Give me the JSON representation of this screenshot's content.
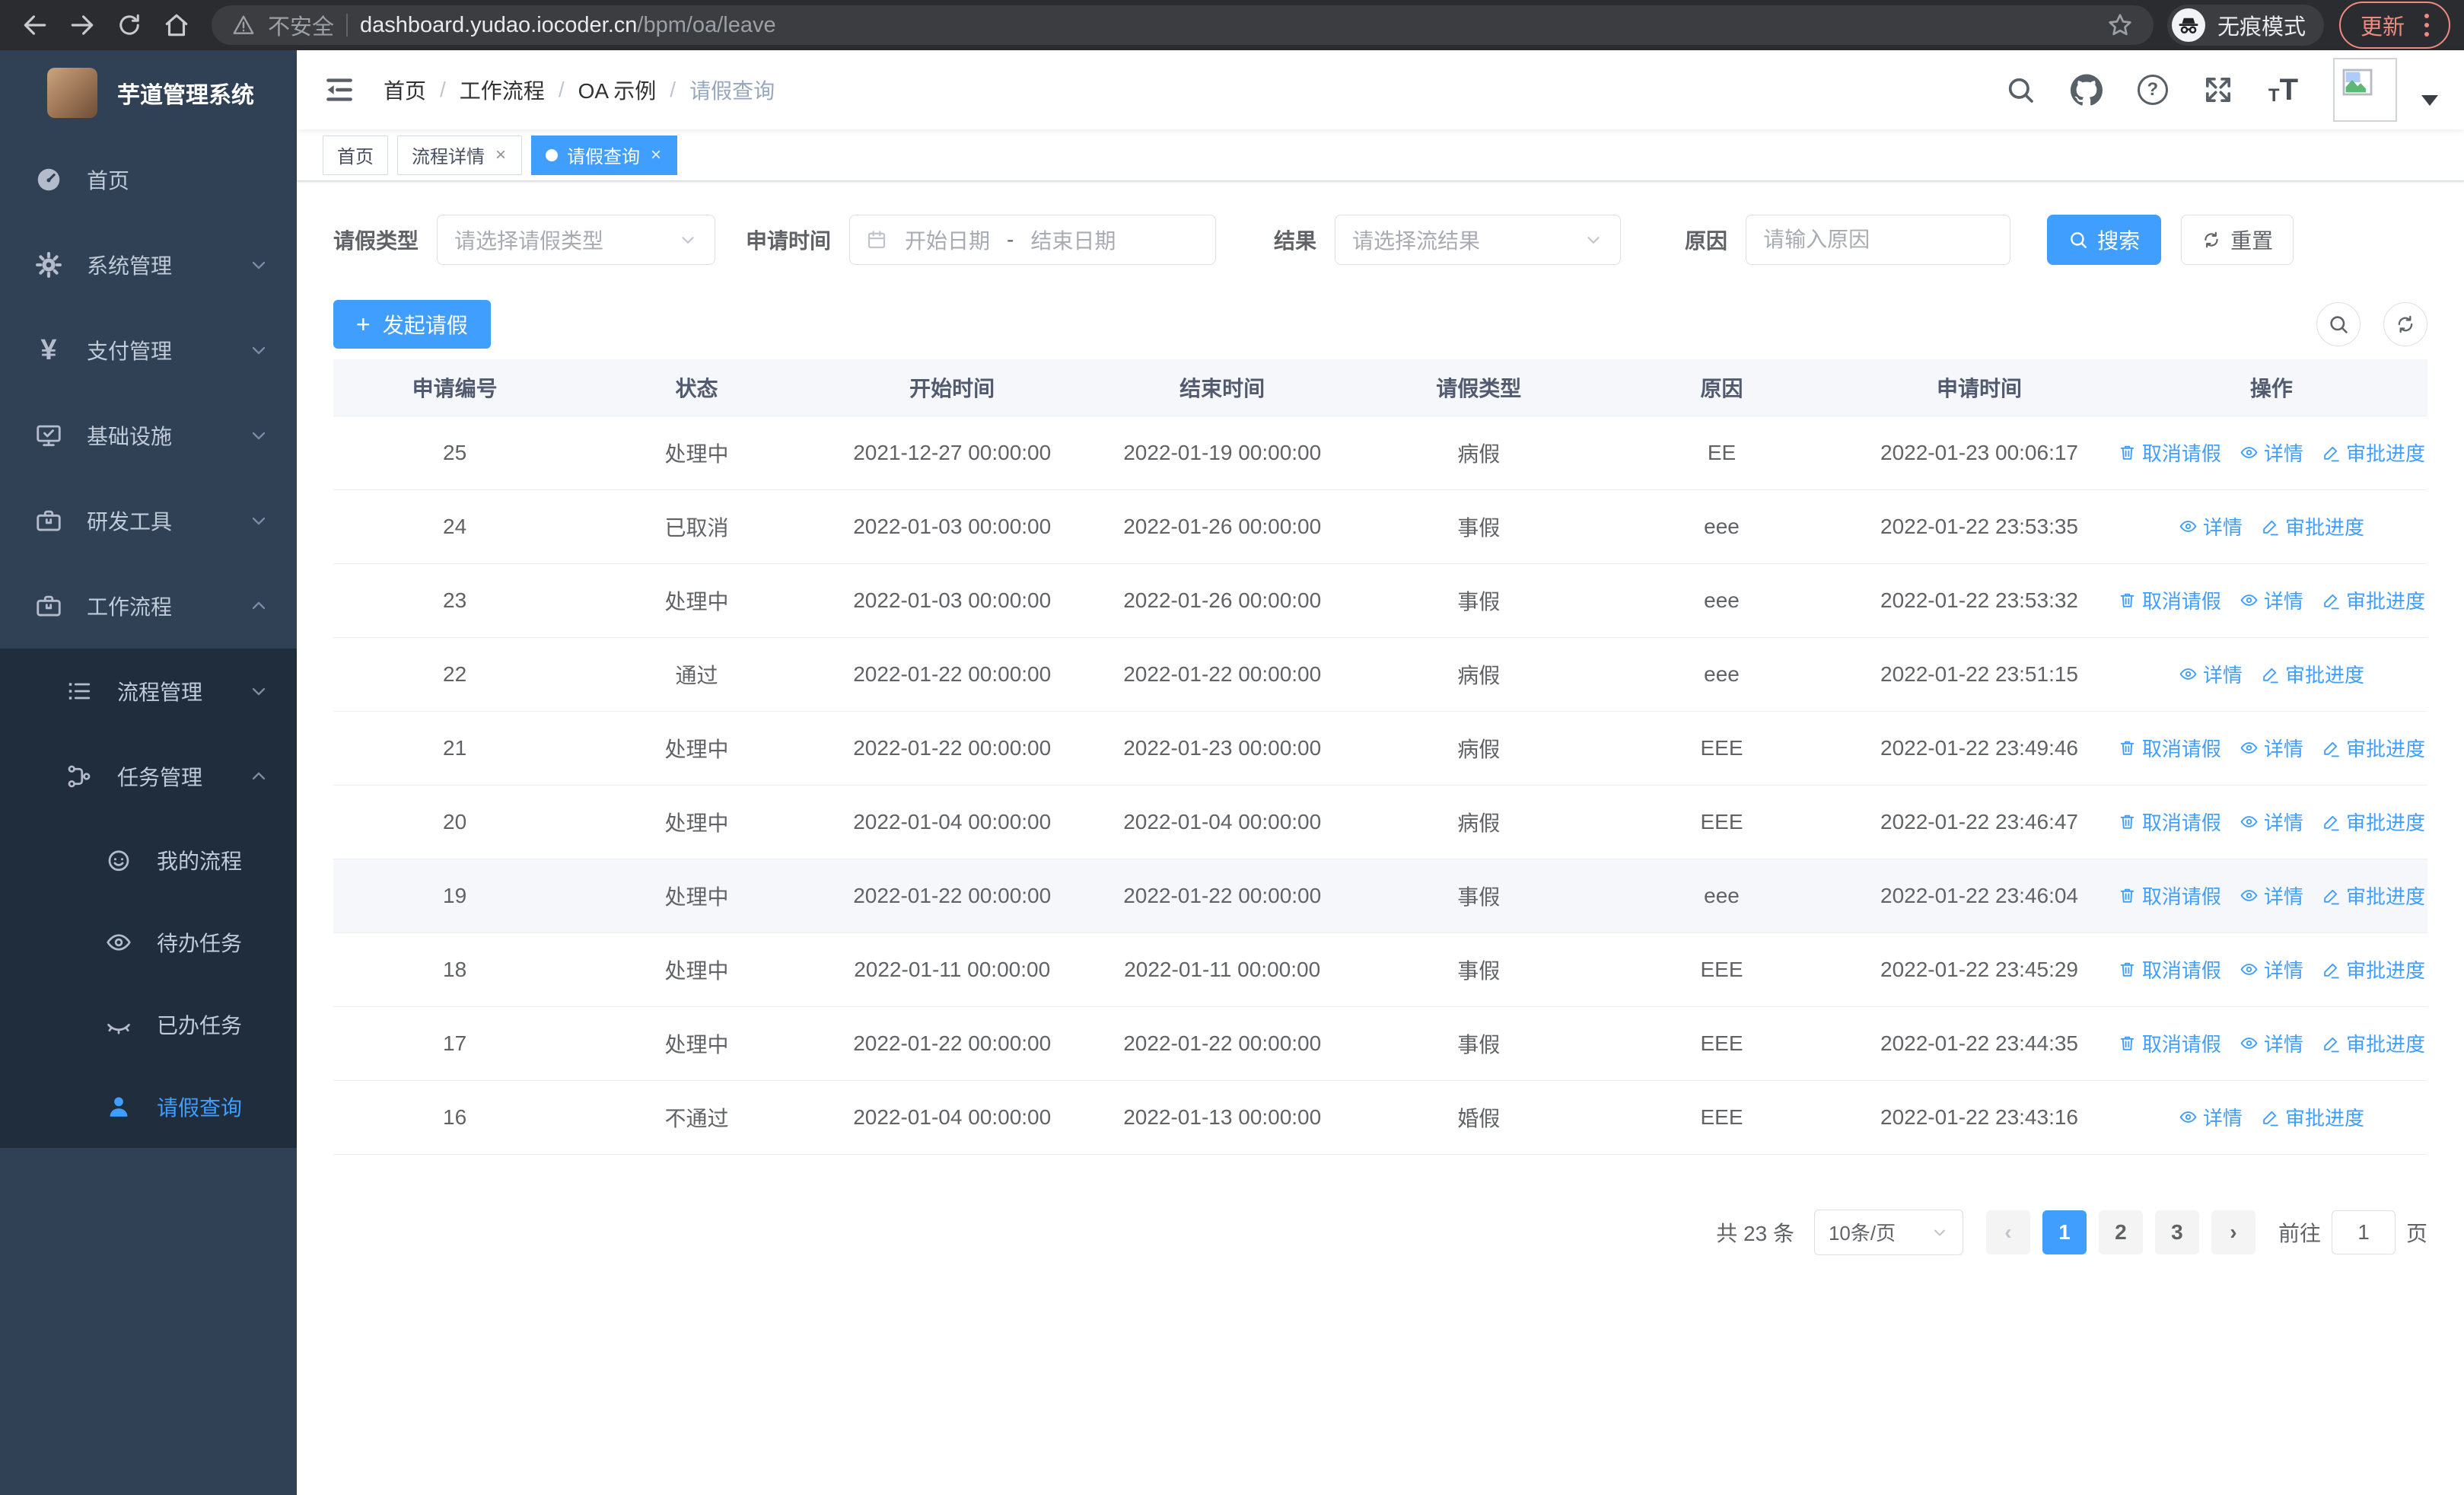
{
  "colors": {
    "primary": "#409eff",
    "sidebar_bg": "#304156",
    "submenu_bg": "#1f2d3d",
    "chrome_accent": "#ef8a80"
  },
  "browser": {
    "security_label": "不安全",
    "url_host": "dashboard.yudao.iocoder.cn",
    "url_path": "/bpm/oa/leave",
    "incognito_label": "无痕模式",
    "update_label": "更新"
  },
  "sidebar": {
    "app_title": "芋道管理系统",
    "items": [
      {
        "label": "首页"
      },
      {
        "label": "系统管理"
      },
      {
        "label": "支付管理"
      },
      {
        "label": "基础设施"
      },
      {
        "label": "研发工具"
      },
      {
        "label": "工作流程"
      }
    ],
    "workflow_children": [
      {
        "label": "流程管理"
      },
      {
        "label": "任务管理"
      }
    ],
    "task_children": [
      {
        "label": "我的流程"
      },
      {
        "label": "待办任务"
      },
      {
        "label": "已办任务"
      },
      {
        "label": "请假查询"
      }
    ],
    "yen_glyph": "¥"
  },
  "header": {
    "breadcrumb": [
      "首页",
      "工作流程",
      "OA 示例",
      "请假查询"
    ],
    "separator": "/"
  },
  "tabs": [
    {
      "label": "首页"
    },
    {
      "label": "流程详情"
    },
    {
      "label": "请假查询"
    }
  ],
  "ui": {
    "close": "×",
    "plus": "+",
    "question": "?",
    "range_separator": "-",
    "font_small": "T",
    "font_large": "T"
  },
  "filters": {
    "leave_type": {
      "label": "请假类型",
      "placeholder": "请选择请假类型"
    },
    "apply_time": {
      "label": "申请时间",
      "start_placeholder": "开始日期",
      "end_placeholder": "结束日期"
    },
    "result": {
      "label": "结果",
      "placeholder": "请选择流结果"
    },
    "reason": {
      "label": "原因",
      "placeholder": "请输入原因"
    },
    "search_label": "搜索",
    "reset_label": "重置"
  },
  "toolbar": {
    "create_label": "发起请假"
  },
  "table": {
    "columns": [
      "申请编号",
      "状态",
      "开始时间",
      "结束时间",
      "请假类型",
      "原因",
      "申请时间",
      "操作"
    ],
    "action_labels": {
      "cancel": "取消请假",
      "detail": "详情",
      "progress": "审批进度"
    },
    "rows": [
      {
        "id": "25",
        "status": "处理中",
        "start": "2021-12-27 00:00:00",
        "end": "2022-01-19 00:00:00",
        "type": "病假",
        "reason": "EE",
        "apply": "2022-01-23 00:06:17"
      },
      {
        "id": "24",
        "status": "已取消",
        "start": "2022-01-03 00:00:00",
        "end": "2022-01-26 00:00:00",
        "type": "事假",
        "reason": "eee",
        "apply": "2022-01-22 23:53:35"
      },
      {
        "id": "23",
        "status": "处理中",
        "start": "2022-01-03 00:00:00",
        "end": "2022-01-26 00:00:00",
        "type": "事假",
        "reason": "eee",
        "apply": "2022-01-22 23:53:32"
      },
      {
        "id": "22",
        "status": "通过",
        "start": "2022-01-22 00:00:00",
        "end": "2022-01-22 00:00:00",
        "type": "病假",
        "reason": "eee",
        "apply": "2022-01-22 23:51:15"
      },
      {
        "id": "21",
        "status": "处理中",
        "start": "2022-01-22 00:00:00",
        "end": "2022-01-23 00:00:00",
        "type": "病假",
        "reason": "EEE",
        "apply": "2022-01-22 23:49:46"
      },
      {
        "id": "20",
        "status": "处理中",
        "start": "2022-01-04 00:00:00",
        "end": "2022-01-04 00:00:00",
        "type": "病假",
        "reason": "EEE",
        "apply": "2022-01-22 23:46:47"
      },
      {
        "id": "19",
        "status": "处理中",
        "start": "2022-01-22 00:00:00",
        "end": "2022-01-22 00:00:00",
        "type": "事假",
        "reason": "eee",
        "apply": "2022-01-22 23:46:04"
      },
      {
        "id": "18",
        "status": "处理中",
        "start": "2022-01-11 00:00:00",
        "end": "2022-01-11 00:00:00",
        "type": "事假",
        "reason": "EEE",
        "apply": "2022-01-22 23:45:29"
      },
      {
        "id": "17",
        "status": "处理中",
        "start": "2022-01-22 00:00:00",
        "end": "2022-01-22 00:00:00",
        "type": "事假",
        "reason": "EEE",
        "apply": "2022-01-22 23:44:35"
      },
      {
        "id": "16",
        "status": "不通过",
        "start": "2022-01-04 00:00:00",
        "end": "2022-01-13 00:00:00",
        "type": "婚假",
        "reason": "EEE",
        "apply": "2022-01-22 23:43:16"
      }
    ]
  },
  "pagination": {
    "total": "共 23 条",
    "page_size": "10条/页",
    "prev": "‹",
    "next": "›",
    "pages": [
      "1",
      "2",
      "3"
    ],
    "goto_label": "前往",
    "goto_value": "1",
    "page_unit": "页"
  }
}
